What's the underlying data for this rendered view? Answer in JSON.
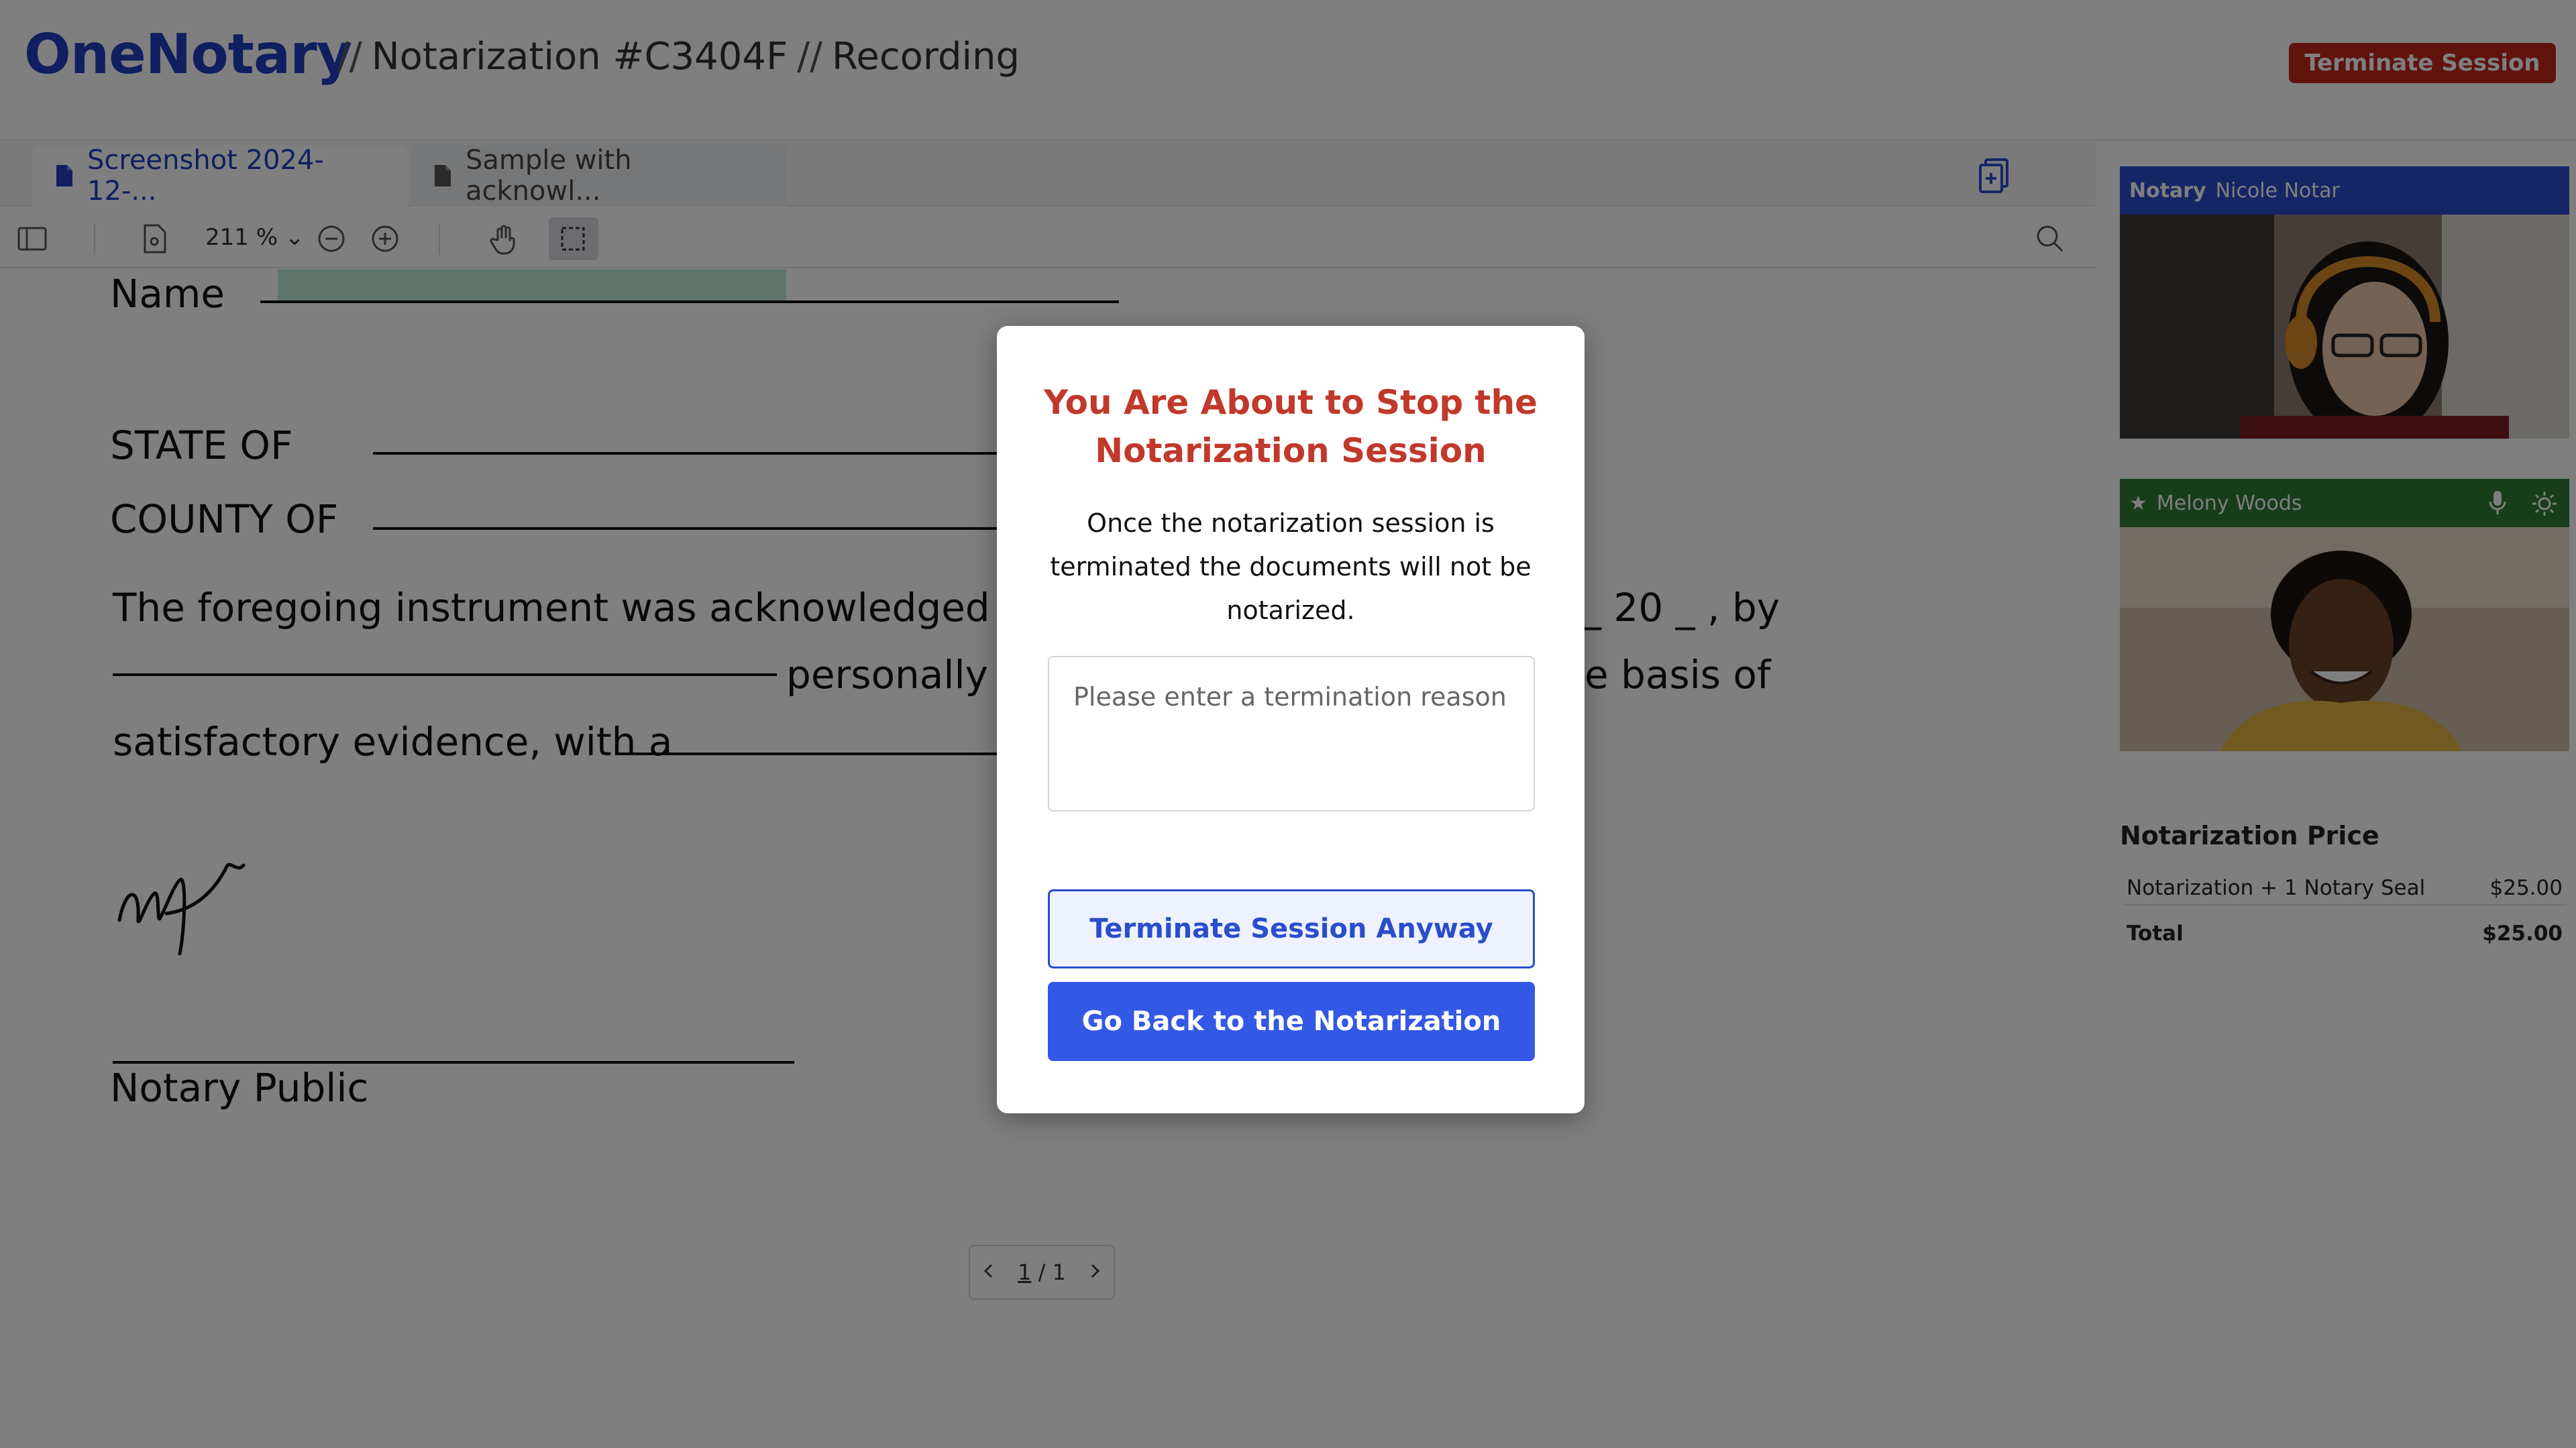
{
  "header": {
    "logo": "OneNotary",
    "separator": "//",
    "notarization": "Notarization #C3404F",
    "status": "Recording",
    "terminate_label": "Terminate Session"
  },
  "tabs": [
    {
      "label": "Screenshot 2024-12-...",
      "active": true
    },
    {
      "label": "Sample with acknowl...",
      "active": false
    }
  ],
  "toolbar": {
    "zoom": "211 %"
  },
  "document": {
    "name_label": "Name",
    "state_label": "STATE OF",
    "county_label": "COUNTY OF",
    "line1_start": "The foregoing instrument was acknowledged befor",
    "line1_end": "_ 20 _ , by",
    "line2_mid": "personally k",
    "line2_end": "e basis of",
    "line3": "satisfactory evidence, with a",
    "signature_caption": "Notary Public"
  },
  "pager": {
    "current": "1",
    "separator": "/",
    "total": "1"
  },
  "participants": {
    "notary_role": "Notary",
    "notary_name": "Nicole Notar",
    "signer_name": "Melony Woods"
  },
  "pricing": {
    "title": "Notarization Price",
    "items": [
      {
        "label": "Notarization + 1 Notary Seal",
        "amount": "$25.00"
      }
    ],
    "total_label": "Total",
    "total_amount": "$25.00"
  },
  "modal": {
    "title": "You Are About to Stop the Notarization Session",
    "message": "Once the notarization session is terminated the documents will not be notarized.",
    "reason_placeholder": "Please enter a termination reason",
    "reason_value": "",
    "terminate_anyway_label": "Terminate Session Anyway",
    "go_back_label": "Go Back to the Notarization"
  },
  "colors": {
    "brand": "#1f3fbf",
    "danger": "#c0261b",
    "primary_button": "#3458e6",
    "notary_label_bg": "#2a4dcc",
    "signer_label_bg": "#2e7d32",
    "modal_title": "#c0392b"
  },
  "icons": {
    "tab_file": "file-icon",
    "add_document": "add-document-icon",
    "sidebar_toggle": "sidebar-toggle-icon",
    "page_view": "page-icon",
    "zoom_out": "zoom-out-icon",
    "zoom_in": "zoom-in-icon",
    "pan": "hand-icon",
    "select": "selection-icon",
    "search": "search-icon",
    "mic": "mic-icon",
    "settings": "gear-icon",
    "star": "star-icon"
  }
}
